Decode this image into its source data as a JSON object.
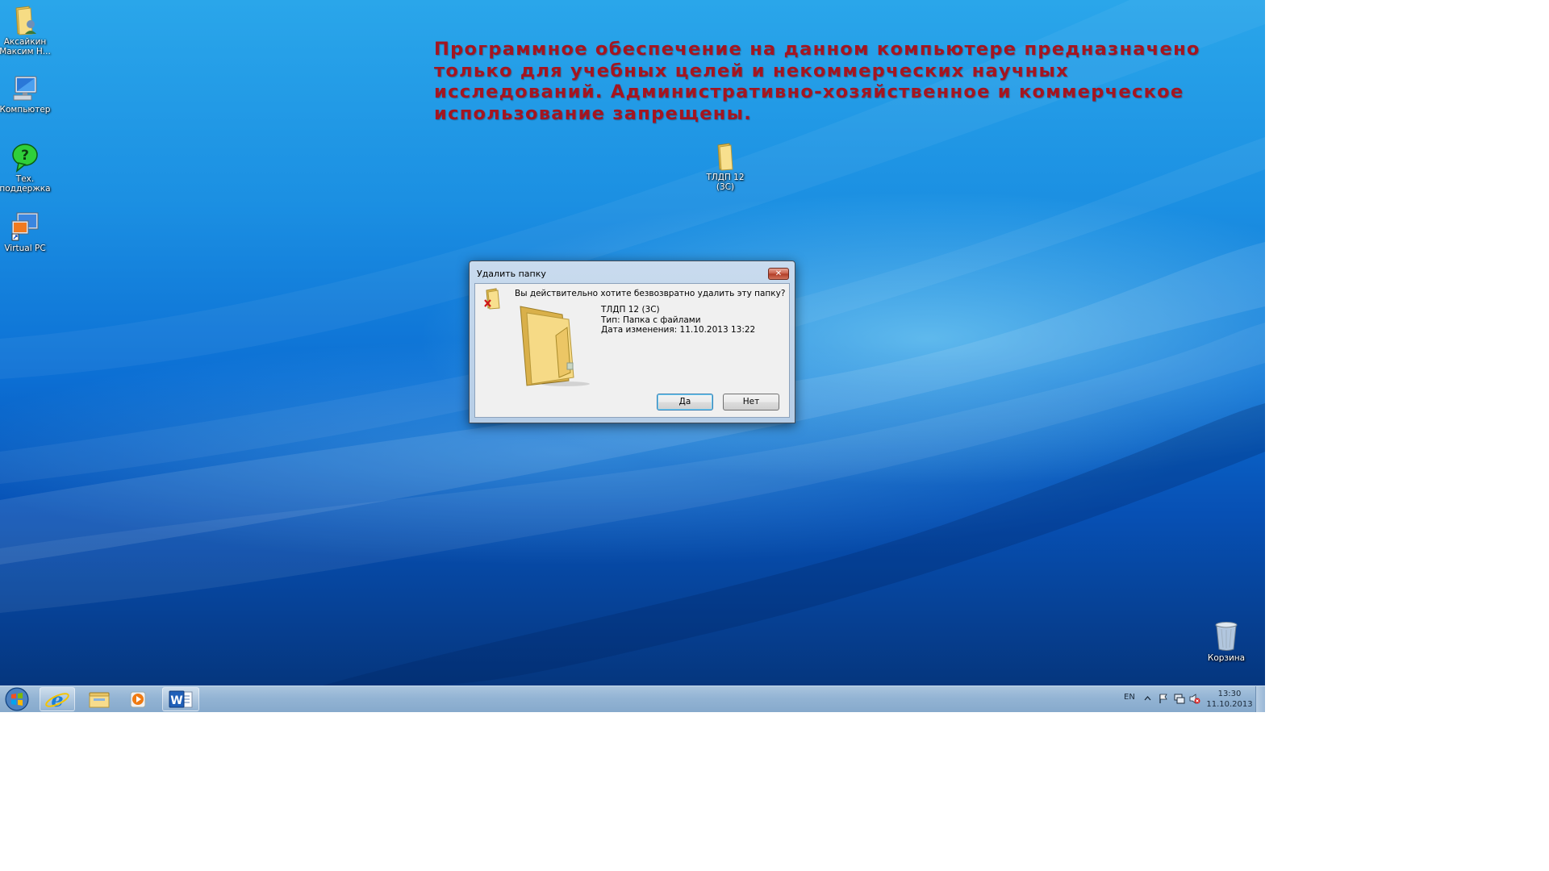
{
  "desktop": {
    "notice_text": "Программное обеспечение на данном компьютере предназначено\nтолько для учебных целей и некоммерческих научных\nисследований.  Административно-хозяйственное и коммерческое\nиспользование запрещены.",
    "notice_color": "#a41520",
    "icons": [
      {
        "label": "Аксайкин Максим Н...",
        "icon": "user-folder-icon"
      },
      {
        "label": "Компьютер",
        "icon": "computer-icon"
      },
      {
        "label": "Тех. поддержка",
        "icon": "help-icon"
      },
      {
        "label": "Virtual PC",
        "icon": "virtual-pc-icon"
      },
      {
        "label": "ТЛДП 12 (3С)",
        "icon": "folder-icon"
      },
      {
        "label": "Корзина",
        "icon": "recycle-bin-icon"
      }
    ]
  },
  "dialog": {
    "title": "Удалить папку",
    "question": "Вы действительно хотите безвозвратно удалить эту папку?",
    "item_name": "ТЛДП 12 (3С)",
    "item_type": "Тип: Папка с файлами",
    "item_modified": "Дата изменения: 11.10.2013 13:22",
    "yes_label": "Да",
    "no_label": "Нет",
    "close_glyph": "✕"
  },
  "taskbar": {
    "pinned": [
      {
        "name": "internet-explorer",
        "icon": "internet-explorer-icon"
      },
      {
        "name": "explorer",
        "icon": "explorer-icon"
      },
      {
        "name": "media-player",
        "icon": "media-player-icon"
      },
      {
        "name": "word",
        "icon": "word-icon",
        "active": true
      }
    ],
    "language": "EN",
    "time": "13:30",
    "date": "11.10.2013"
  }
}
